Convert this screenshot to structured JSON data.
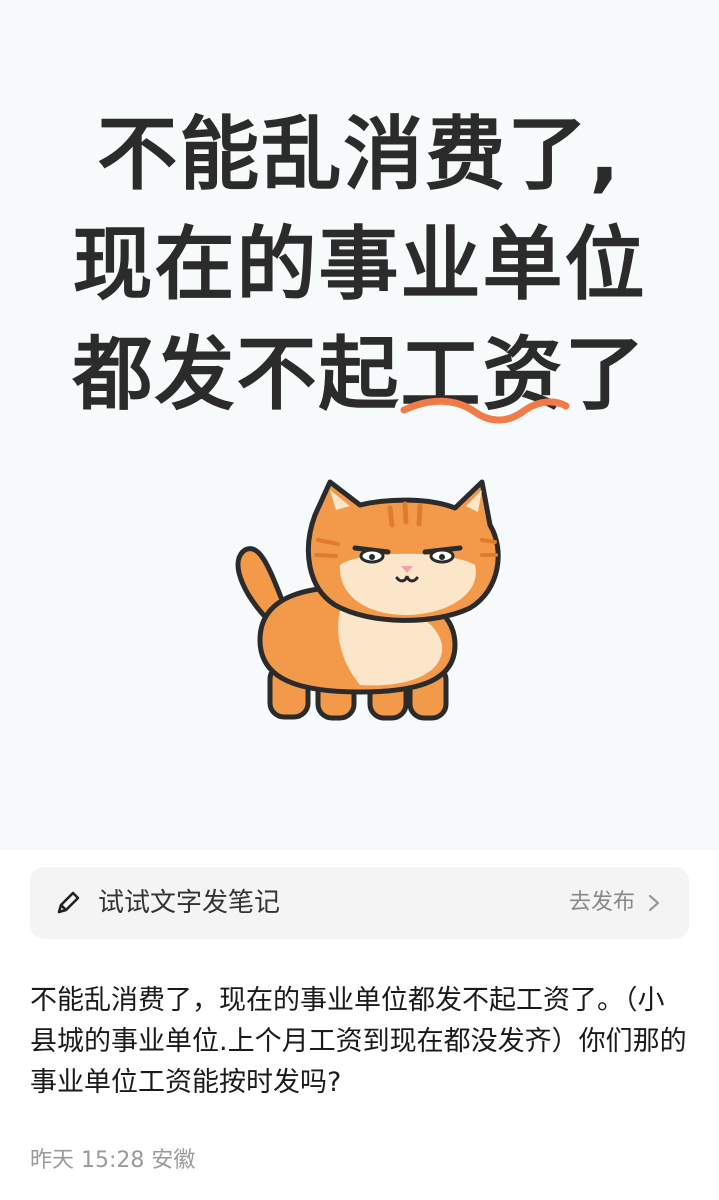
{
  "headline": {
    "line1": "不能乱消费了,",
    "line2": "现在的事业单位",
    "line3": "都发不起工资了"
  },
  "compose": {
    "prompt": "试试文字发笔记",
    "action": "去发布",
    "icons": {
      "left": "pencil-icon",
      "right": "chevron-right-icon"
    }
  },
  "post": {
    "text": "不能乱消费了，现在的事业单位都发不起工资了。（小县城的事业单位.上个月工资到现在都没发齐）你们那的事业单位工资能按时发吗?",
    "meta": "昨天 15:28 安徽"
  },
  "colors": {
    "hero_bg": "#f6fafa",
    "headline": "#2b2b2b",
    "accent_underline": "#f07a48",
    "cat_orange": "#f39a4a",
    "cat_cream": "#fbe6c9"
  }
}
